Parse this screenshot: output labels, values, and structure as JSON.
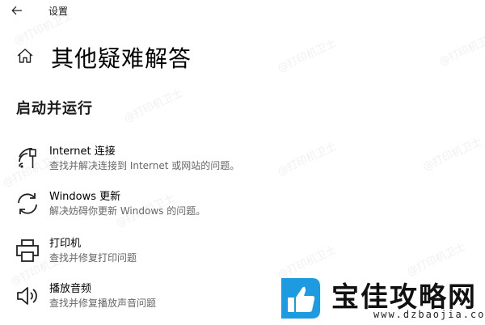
{
  "window": {
    "title": "设置"
  },
  "header": {
    "title": "其他疑难解答"
  },
  "section": {
    "title": "启动并运行"
  },
  "items": [
    {
      "label": "Internet 连接",
      "desc": "查找并解决连接到 Internet 或网站的问题。",
      "icon": "wifi-ethernet-icon"
    },
    {
      "label": "Windows 更新",
      "desc": "解决妨碍你更新 Windows 的问题。",
      "icon": "sync-icon"
    },
    {
      "label": "打印机",
      "desc": "查找并修复打印问题",
      "icon": "printer-icon"
    },
    {
      "label": "播放音频",
      "desc": "查找并修复播放声音问题",
      "icon": "speaker-icon"
    }
  ],
  "watermark": {
    "text": "@打印机卫士"
  },
  "logo": {
    "text": "宝佳攻略网",
    "url": "www.dzbaojia.com"
  },
  "colors": {
    "background": "#ffffff",
    "text": "#000000",
    "secondary_text": "#666666",
    "logo_blue": "#1e9be0"
  }
}
